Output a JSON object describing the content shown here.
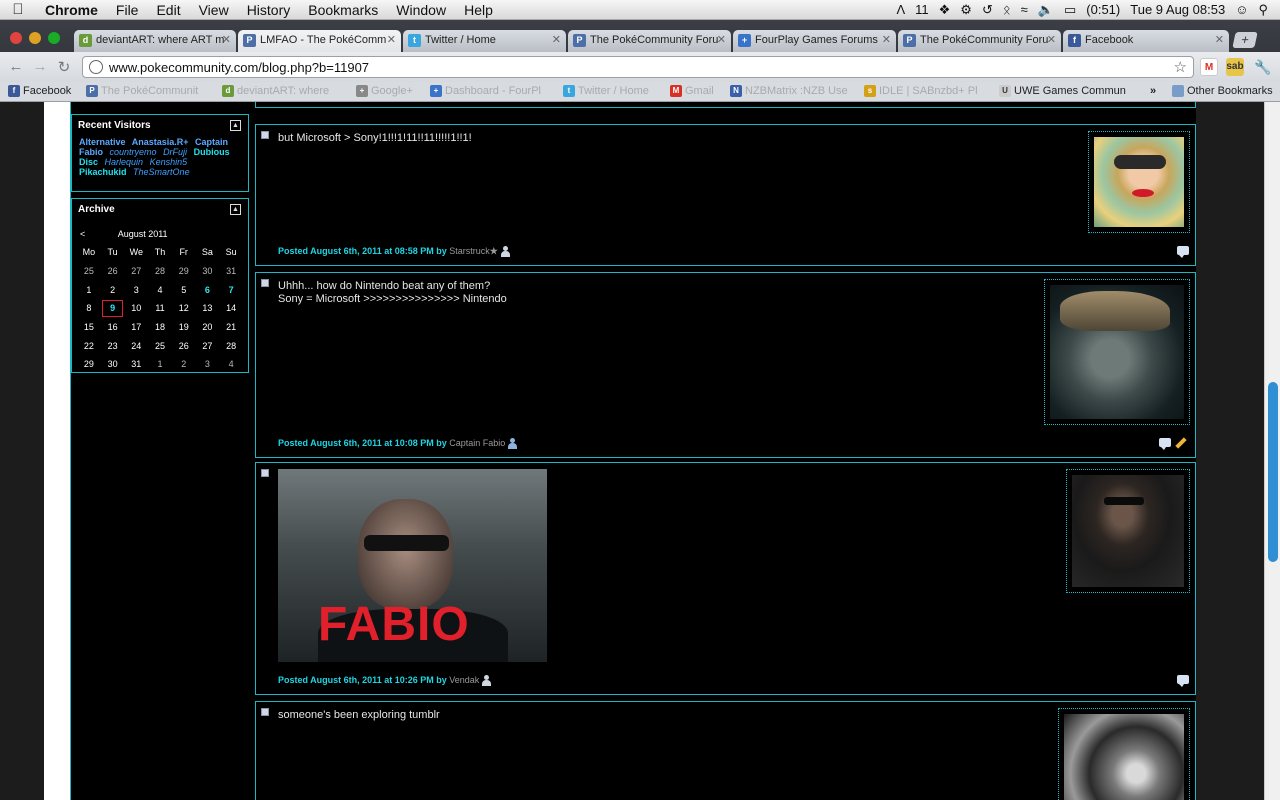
{
  "menubar": {
    "app": "Chrome",
    "items": [
      "File",
      "Edit",
      "View",
      "History",
      "Bookmarks",
      "Window",
      "Help"
    ],
    "status": {
      "adobe_count": "11",
      "battery": "(0:51)",
      "datetime": "Tue 9 Aug  08:53"
    }
  },
  "tabs": [
    {
      "title": "deviantART: where ART m",
      "icon_color": "#6a9a3a"
    },
    {
      "title": "LMFAO - The PokéComm",
      "icon_color": "#4d6fa8"
    },
    {
      "title": "Twitter / Home",
      "icon_color": "#3aa6e0"
    },
    {
      "title": "The PokéCommunity Foru",
      "icon_color": "#4d6fa8"
    },
    {
      "title": "FourPlay Games Forums",
      "icon_color": "#3a74c8"
    },
    {
      "title": "The PokéCommunity Foru",
      "icon_color": "#4d6fa8"
    },
    {
      "title": "Facebook",
      "icon_color": "#3b5998"
    }
  ],
  "address": {
    "url": "www.pokecommunity.com/blog.php?b=11907"
  },
  "bookmarks": [
    {
      "label": "Facebook",
      "icon_color": "#3b5998"
    },
    {
      "label": "The PokéCommunit",
      "icon_color": "#4d6fa8"
    },
    {
      "label": "deviantART: where",
      "icon_color": "#6a9a3a"
    },
    {
      "label": "Google+",
      "icon_color": "#888888"
    },
    {
      "label": "Dashboard - FourPl",
      "icon_color": "#3a74c8"
    },
    {
      "label": "Twitter / Home",
      "icon_color": "#3aa6e0"
    },
    {
      "label": "Gmail",
      "icon_color": "#d93025"
    },
    {
      "label": "NZBMatrix :NZB Use",
      "icon_color": "#3a5ea8"
    },
    {
      "label": "IDLE | SABnzbd+ Pl",
      "icon_color": "#d4a017"
    },
    {
      "label": "UWE Games Commun",
      "icon_color": "#cccccc"
    },
    {
      "label": "Other Bookmarks",
      "icon_color": "#7a9cc8"
    }
  ],
  "sidebar": {
    "visitors_title": "Recent Visitors",
    "visitors": [
      {
        "name": "Alternative",
        "style": "blue"
      },
      {
        "name": "Anastasia.R+",
        "style": "blue"
      },
      {
        "name": "Captain Fabio",
        "style": "blue"
      },
      {
        "name": "countryemo",
        "style": "it"
      },
      {
        "name": "DrFuji",
        "style": "it"
      },
      {
        "name": "Dubious Disc",
        "style": "cyan"
      },
      {
        "name": "Harlequin",
        "style": "it"
      },
      {
        "name": "Kenshin5",
        "style": "it"
      },
      {
        "name": "Pikachukid",
        "style": "cyan"
      },
      {
        "name": "TheSmartOne",
        "style": "it"
      }
    ],
    "archive_title": "Archive",
    "calendar": {
      "prev": "<",
      "month": "August 2011",
      "weekdays": [
        "Mo",
        "Tu",
        "We",
        "Th",
        "Fr",
        "Sa",
        "Su"
      ],
      "weeks": [
        [
          "25",
          "26",
          "27",
          "28",
          "29",
          "30",
          "31"
        ],
        [
          "1",
          "2",
          "3",
          "4",
          "5",
          "6",
          "7"
        ],
        [
          "8",
          "9",
          "10",
          "11",
          "12",
          "13",
          "14"
        ],
        [
          "15",
          "16",
          "17",
          "18",
          "19",
          "20",
          "21"
        ],
        [
          "22",
          "23",
          "24",
          "25",
          "26",
          "27",
          "28"
        ],
        [
          "29",
          "30",
          "31",
          "1",
          "2",
          "3",
          "4"
        ]
      ],
      "highlighted": [
        "6",
        "7"
      ],
      "today": "9"
    }
  },
  "posts": [
    {
      "lines": [
        "but Microsoft > Sony!1!!!1!11!!11!!!!!1!!1!"
      ],
      "meta": "Posted August 6th, 2011 at 08:58 PM by",
      "user": "Starstruck"
    },
    {
      "lines": [
        "Uhhh... how do Nintendo beat any of them?",
        "Sony = Microsoft >>>>>>>>>>>>>>> Nintendo"
      ],
      "meta": "Posted August 6th, 2011 at 10:08 PM by",
      "user": "Captain Fabio"
    },
    {
      "lines": [],
      "image_caption": "FABIO",
      "meta": "Posted August 6th, 2011 at 10:26 PM by",
      "user": "Vendak"
    },
    {
      "lines": [
        "someone's been exploring tumblr"
      ]
    }
  ]
}
